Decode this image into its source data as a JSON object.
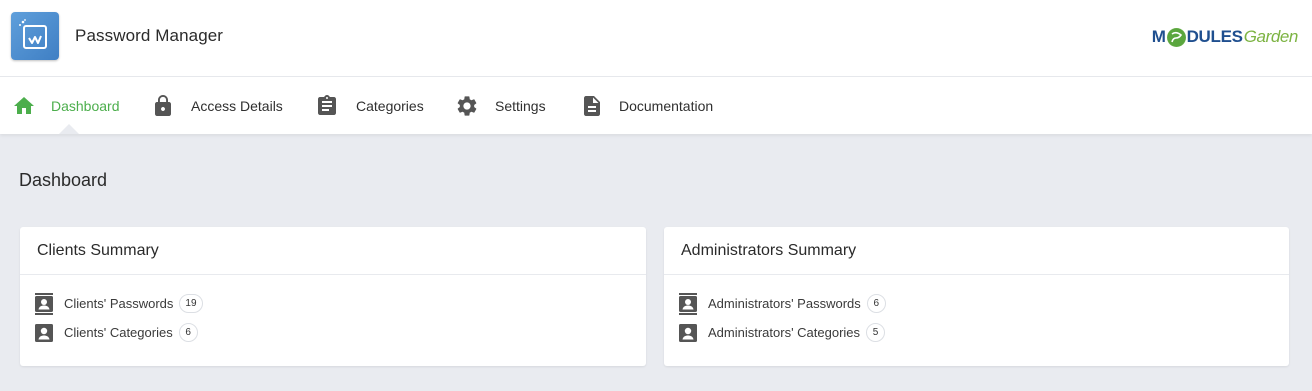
{
  "header": {
    "app_title": "Password Manager",
    "brand": {
      "part1": "M",
      "part2": "DULES",
      "part3": "Garden"
    }
  },
  "nav": {
    "items": [
      {
        "label": "Dashboard",
        "icon": "home-icon",
        "active": true
      },
      {
        "label": "Access Details",
        "icon": "lock-icon",
        "active": false
      },
      {
        "label": "Categories",
        "icon": "clipboard-icon",
        "active": false
      },
      {
        "label": "Settings",
        "icon": "gear-icon",
        "active": false
      },
      {
        "label": "Documentation",
        "icon": "document-icon",
        "active": false
      }
    ]
  },
  "page": {
    "title": "Dashboard"
  },
  "clients_summary": {
    "title": "Clients Summary",
    "rows": [
      {
        "label": "Clients' Passwords",
        "count": "19",
        "icon": "contacts-book-icon"
      },
      {
        "label": "Clients' Categories",
        "count": "6",
        "icon": "account-box-icon"
      }
    ]
  },
  "admins_summary": {
    "title": "Administrators Summary",
    "rows": [
      {
        "label": "Administrators' Passwords",
        "count": "6",
        "icon": "contacts-book-icon"
      },
      {
        "label": "Administrators' Categories",
        "count": "5",
        "icon": "account-box-icon"
      }
    ]
  },
  "colors": {
    "accent": "#4cae4c",
    "icon": "#555555",
    "background": "#e9ebf0",
    "brand_blue": "#1f4f8f",
    "brand_green": "#7cb342"
  }
}
